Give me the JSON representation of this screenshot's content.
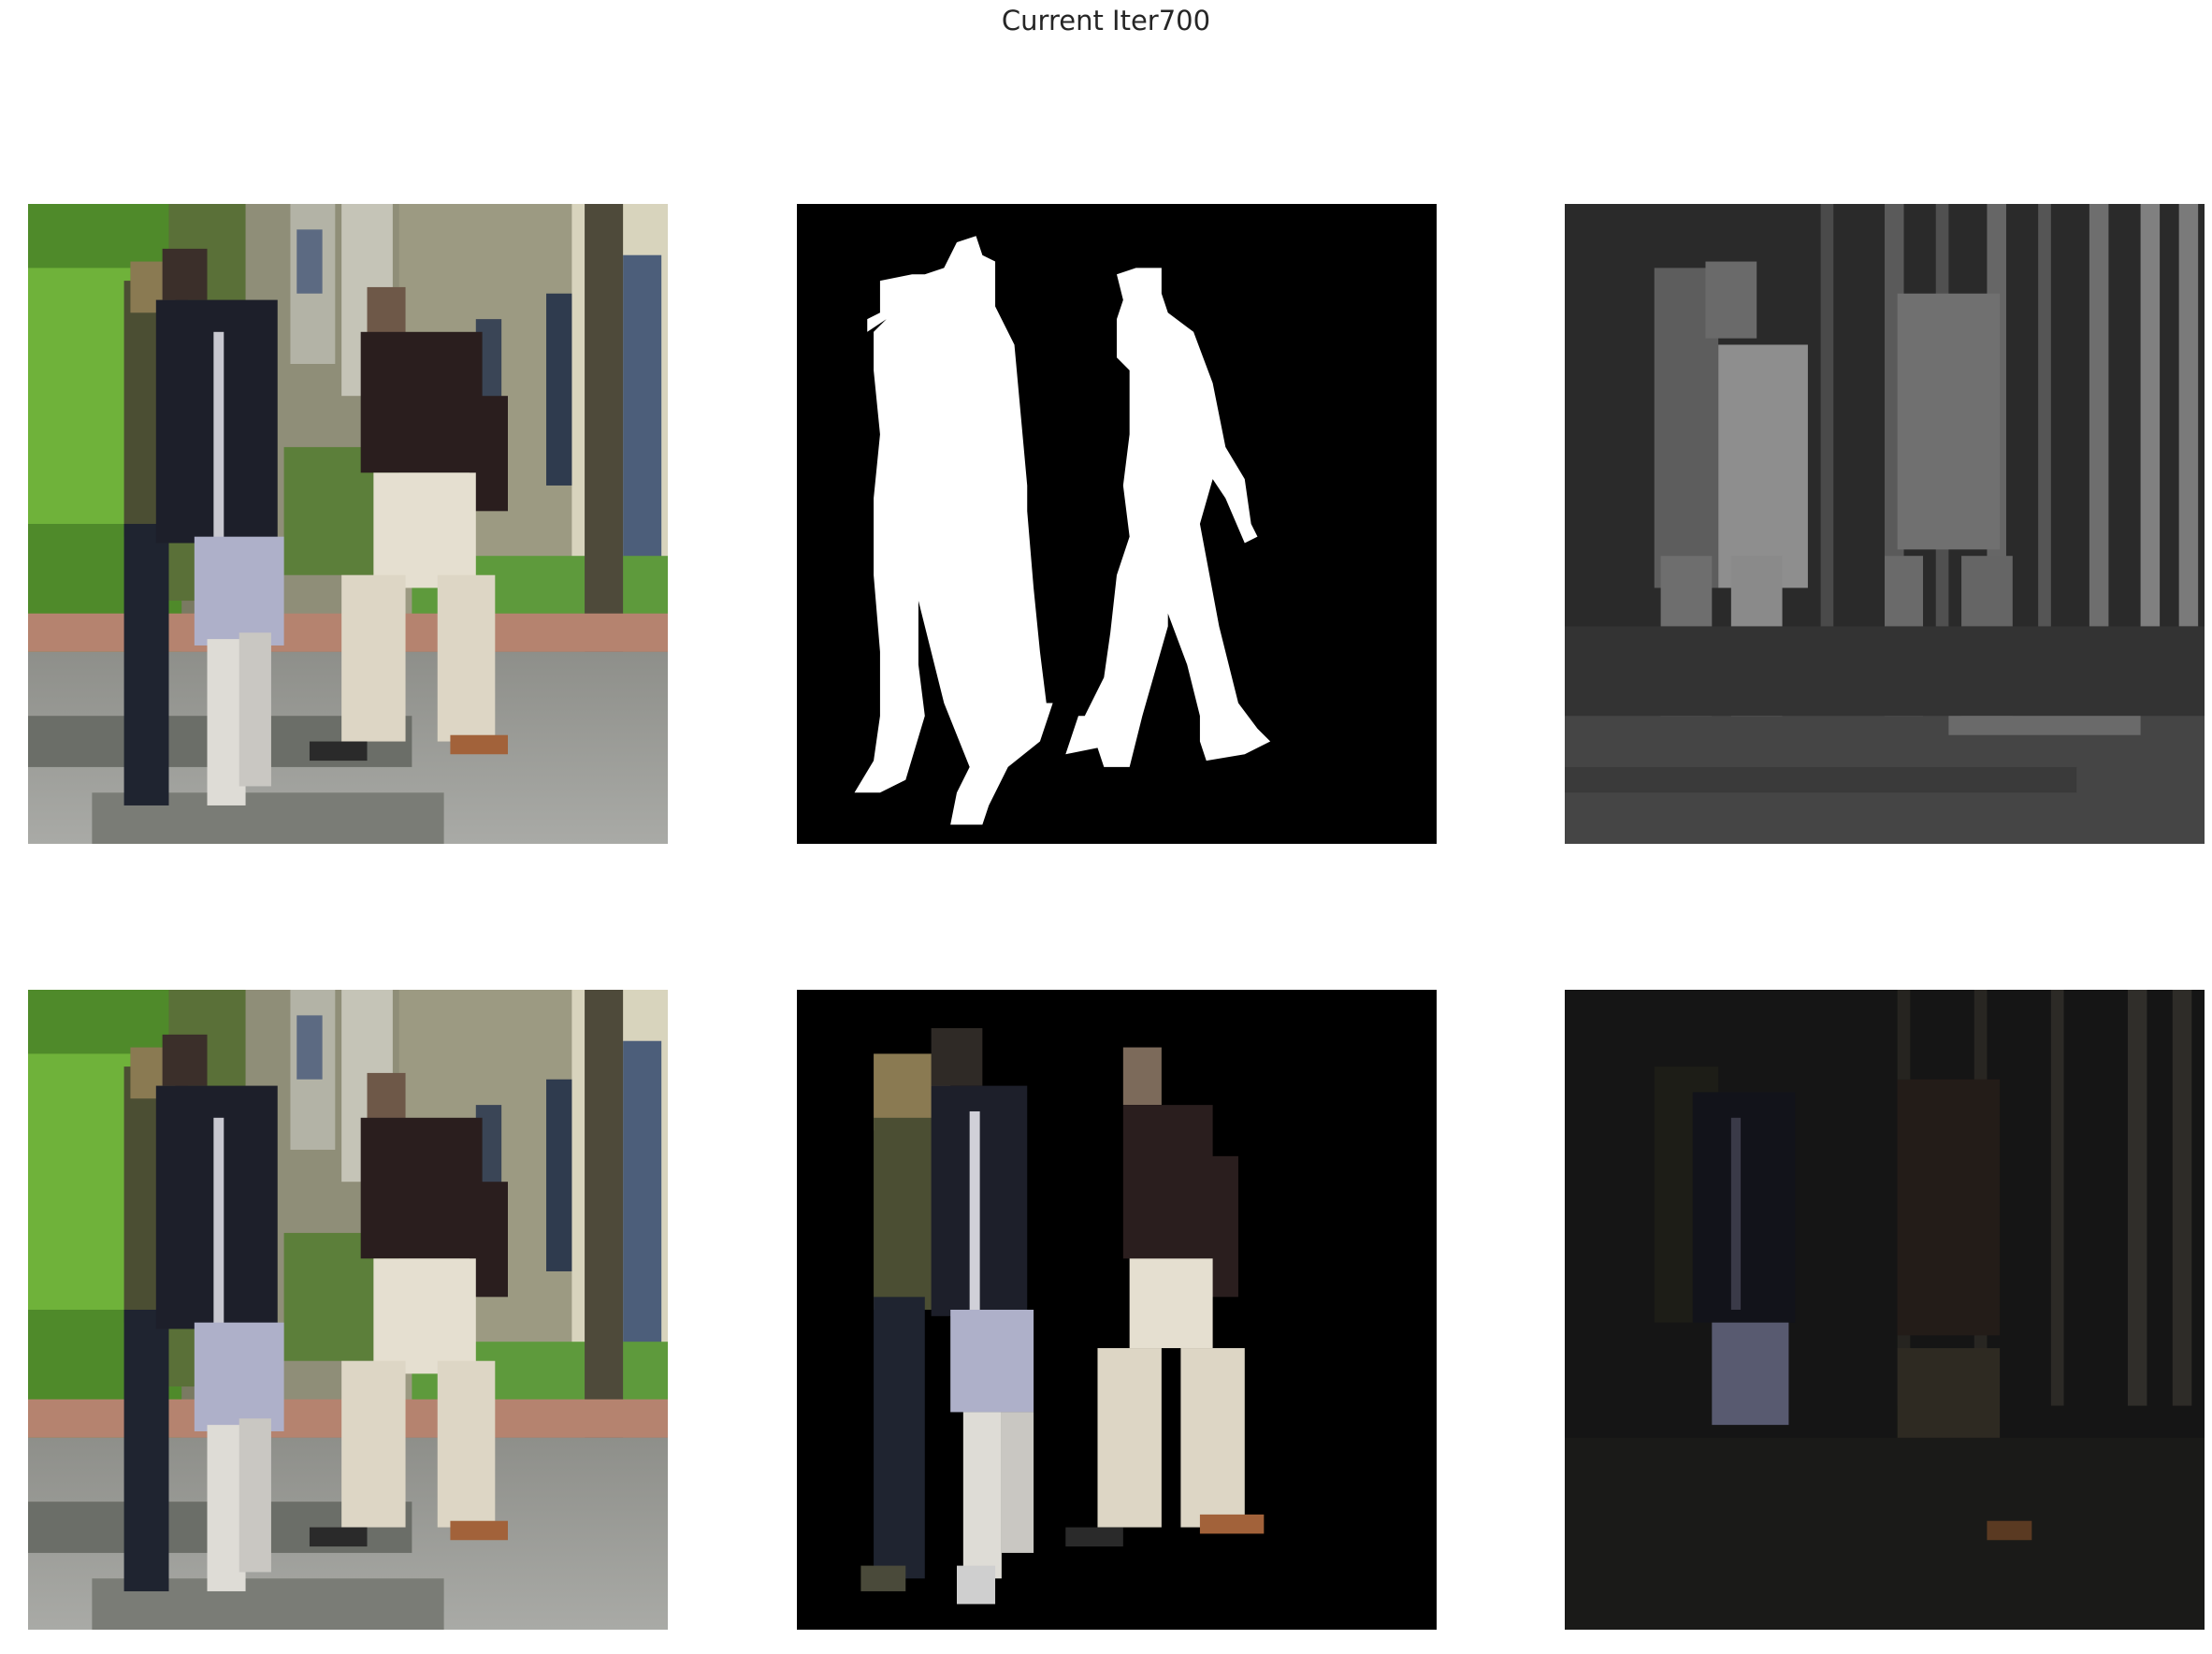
{
  "figure": {
    "title": "Current Iter700"
  },
  "panels": [
    {
      "id": "p11",
      "name": "input-image",
      "content": "photo-scene"
    },
    {
      "id": "p12",
      "name": "ground-truth-mask",
      "content": "binary-silhouette"
    },
    {
      "id": "p13",
      "name": "predicted-mask",
      "content": "grayscale-prediction"
    },
    {
      "id": "p21",
      "name": "input-image-copy",
      "content": "photo-scene"
    },
    {
      "id": "p22",
      "name": "masked-foreground",
      "content": "foreground-on-black"
    },
    {
      "id": "p23",
      "name": "predicted-foreground",
      "content": "dark-prediction"
    }
  ],
  "colors": {
    "title_text": "#262626",
    "mask_white": "#ffffff",
    "mask_black": "#000000"
  }
}
